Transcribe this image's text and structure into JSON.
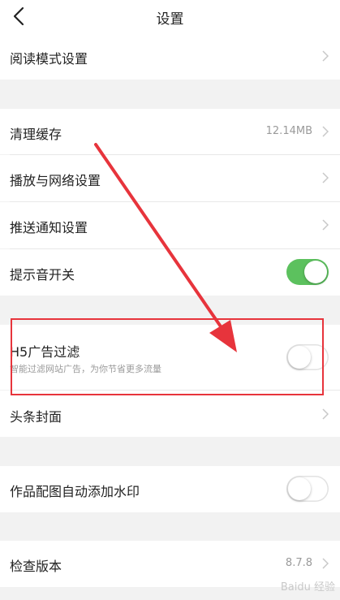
{
  "header": {
    "title": "设置",
    "back_icon": "chevron-left-icon"
  },
  "rows": {
    "reading_mode": {
      "label": "阅读模式设置"
    },
    "clear_cache": {
      "label": "清理缓存",
      "value": "12.14MB"
    },
    "playback_network": {
      "label": "播放与网络设置"
    },
    "push_notifications": {
      "label": "推送通知设置"
    },
    "sound_toggle": {
      "label": "提示音开关",
      "on": true
    },
    "h5_ad_filter": {
      "label": "H5广告过滤",
      "description": "智能过滤网站广告，为你节省更多流量",
      "on": false
    },
    "headline_cover": {
      "label": "头条封面"
    },
    "watermark": {
      "label": "作品配图自动添加水印",
      "on": false
    },
    "check_version": {
      "label": "检查版本",
      "value": "8.7.8"
    }
  },
  "colors": {
    "toggle_on": "#5cc15e",
    "highlight": "#e7343c"
  },
  "watermark_text": "Baidu 经验"
}
